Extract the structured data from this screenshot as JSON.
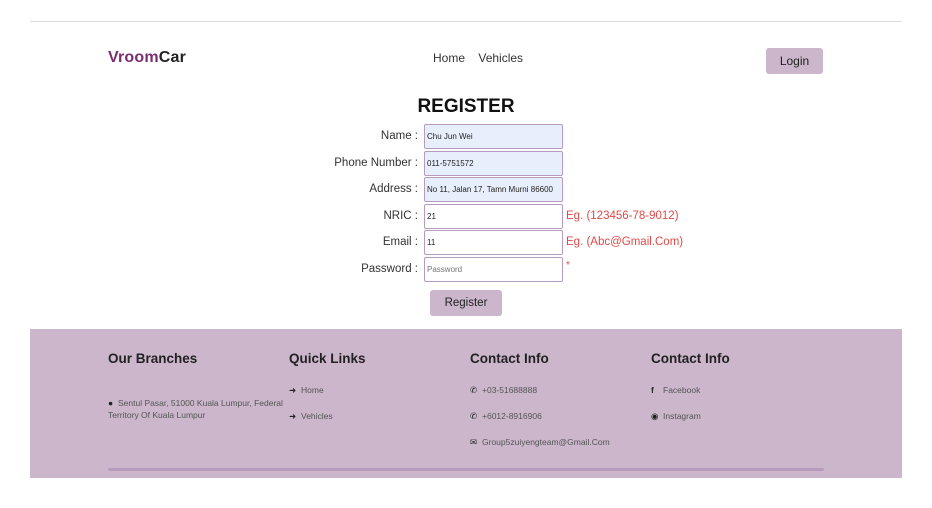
{
  "brand": {
    "part1": "Vroom",
    "part2": "Car"
  },
  "nav": {
    "items": [
      "Home",
      "Vehicles"
    ]
  },
  "login_label": "Login",
  "register": {
    "title": "REGISTER",
    "fields": {
      "name": {
        "label": "Name :",
        "value": "Chu Jun Wei"
      },
      "phone": {
        "label": "Phone Number :",
        "value": "011-5751572"
      },
      "address": {
        "label": "Address :",
        "value": "No 11, Jalan 17, Tamn Murni 86600"
      },
      "nric": {
        "label": "NRIC :",
        "value": "21",
        "hint": "Eg. (123456-78-9012)"
      },
      "email": {
        "label": "Email :",
        "value": "11",
        "hint": "Eg. (Abc@Gmail.Com)"
      },
      "password": {
        "label": "Password :",
        "placeholder": "Password",
        "required_mark": "*"
      }
    },
    "submit_label": "Register"
  },
  "footer": {
    "branches": {
      "title": "Our Branches",
      "address": "Sentul Pasar, 51000 Kuala Lumpur, Federal Territory Of Kuala Lumpur"
    },
    "quick_links": {
      "title": "Quick Links",
      "items": [
        "Home",
        "Vehicles"
      ]
    },
    "contact1": {
      "title": "Contact Info",
      "phone1": "+03-51688888",
      "phone2": "+6012-8916906",
      "email": "Group5zuiyengteam@Gmail.Com"
    },
    "contact2": {
      "title": "Contact Info",
      "facebook": "Facebook",
      "instagram": "Instagram"
    }
  },
  "colors": {
    "brand": "#7b2d6f",
    "accent": "#cbb6cc",
    "error": "#e04848",
    "input_border": "#b79ac0"
  }
}
